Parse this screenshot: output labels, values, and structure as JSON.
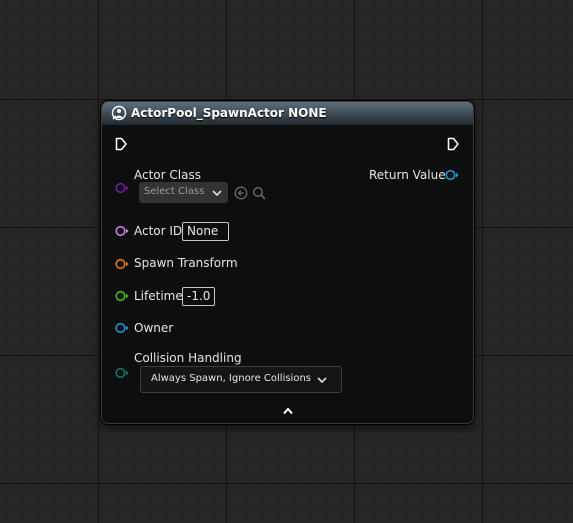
{
  "node": {
    "title": "ActorPool_SpawnActor NONE",
    "header_icon": "function-icon",
    "header_color": "#4a5b68"
  },
  "pins": {
    "actor_class": {
      "label": "Actor Class",
      "color": "#6e1fa8",
      "select_text": "Select Class"
    },
    "return_value": {
      "label": "Return Value",
      "color": "#1c9bd8"
    },
    "actor_id": {
      "label": "Actor ID",
      "color": "#c882e6",
      "value": "None"
    },
    "spawn_transform": {
      "label": "Spawn Transform",
      "color": "#e87a1c"
    },
    "lifetime": {
      "label": "Lifetime",
      "color": "#3ec21a",
      "value": "-1.0"
    },
    "owner": {
      "label": "Owner",
      "color": "#1c9bd8"
    },
    "collision_handling": {
      "label": "Collision Handling",
      "color": "#0a7a6a",
      "value": "Always Spawn, Ignore Collisions"
    }
  },
  "icons": {
    "use_selected": "arrow-left-circle-icon",
    "browse": "search-icon",
    "collapse": "chevron-up-icon"
  }
}
